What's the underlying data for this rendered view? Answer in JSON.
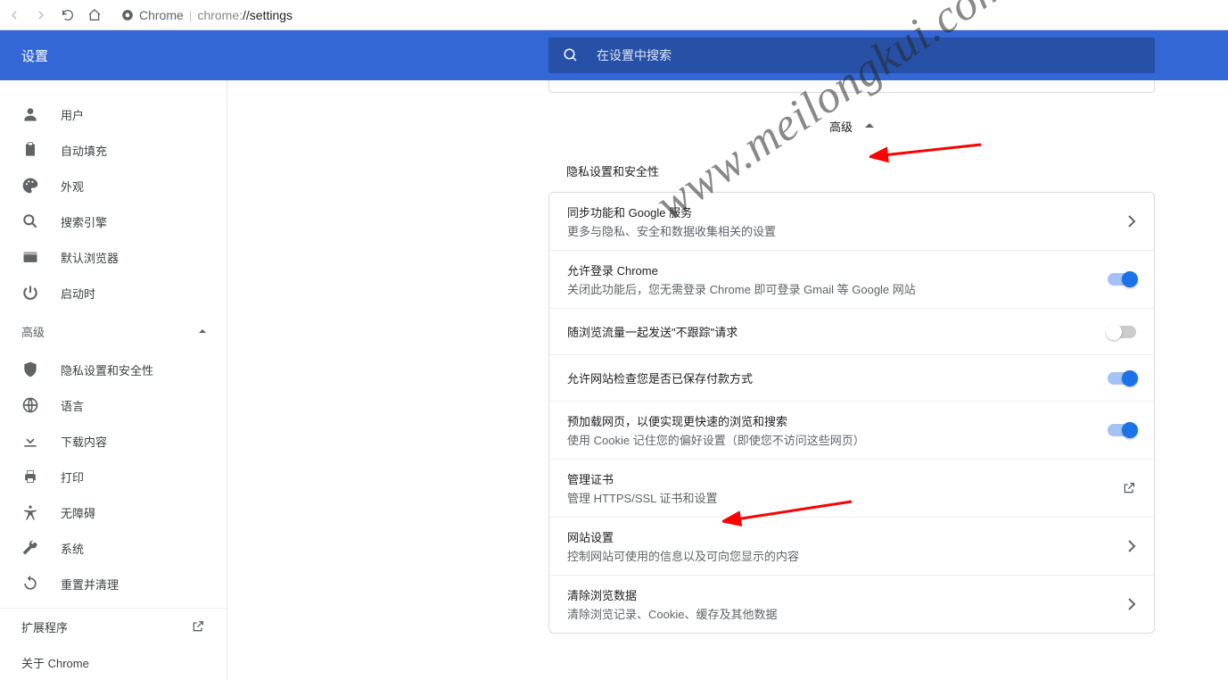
{
  "browser": {
    "label": "Chrome",
    "url_prefix": "chrome:",
    "url_path": "//settings"
  },
  "header": {
    "title": "设置",
    "search_placeholder": "在设置中搜索"
  },
  "sidebar": {
    "main_items": [
      {
        "icon": "person",
        "label": "用户"
      },
      {
        "icon": "clipboard",
        "label": "自动填充"
      },
      {
        "icon": "palette",
        "label": "外观"
      },
      {
        "icon": "search",
        "label": "搜索引擎"
      },
      {
        "icon": "browser",
        "label": "默认浏览器"
      },
      {
        "icon": "power",
        "label": "启动时"
      }
    ],
    "advanced_label": "高级",
    "adv_items": [
      {
        "icon": "shield",
        "label": "隐私设置和安全性"
      },
      {
        "icon": "globe",
        "label": "语言"
      },
      {
        "icon": "download",
        "label": "下载内容"
      },
      {
        "icon": "print",
        "label": "打印"
      },
      {
        "icon": "accessibility",
        "label": "无障碍"
      },
      {
        "icon": "wrench",
        "label": "系统"
      },
      {
        "icon": "reset",
        "label": "重置并清理"
      }
    ],
    "extensions": "扩展程序",
    "about": "关于 Chrome"
  },
  "content": {
    "advanced_toggle": "高级",
    "section_title": "隐私设置和安全性",
    "rows": [
      {
        "title": "同步功能和 Google 服务",
        "sub": "更多与隐私、安全和数据收集相关的设置",
        "ctrl": "arrow"
      },
      {
        "title": "允许登录 Chrome",
        "sub": "关闭此功能后，您无需登录 Chrome 即可登录 Gmail 等 Google 网站",
        "ctrl": "toggle_on"
      },
      {
        "title": "随浏览流量一起发送\"不跟踪\"请求",
        "sub": "",
        "ctrl": "toggle_off"
      },
      {
        "title": "允许网站检查您是否已保存付款方式",
        "sub": "",
        "ctrl": "toggle_on"
      },
      {
        "title": "预加载网页，以便实现更快速的浏览和搜索",
        "sub": "使用 Cookie 记住您的偏好设置（即使您不访问这些网页）",
        "ctrl": "toggle_on"
      },
      {
        "title": "管理证书",
        "sub": "管理 HTTPS/SSL 证书和设置",
        "ctrl": "external"
      },
      {
        "title": "网站设置",
        "sub": "控制网站可使用的信息以及可向您显示的内容",
        "ctrl": "arrow"
      },
      {
        "title": "清除浏览数据",
        "sub": "清除浏览记录、Cookie、缓存及其他数据",
        "ctrl": "arrow"
      }
    ]
  },
  "watermark": "www.meilongkui.com"
}
